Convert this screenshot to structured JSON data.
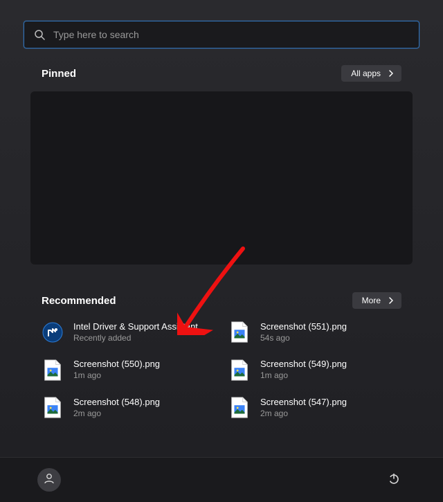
{
  "search": {
    "placeholder": "Type here to search"
  },
  "pinned": {
    "title": "Pinned",
    "all_apps_label": "All apps"
  },
  "recommended": {
    "title": "Recommended",
    "more_label": "More",
    "items": [
      {
        "title": "Intel Driver & Support Assistant",
        "sub": "Recently added",
        "icon": "intel"
      },
      {
        "title": "Screenshot (551).png",
        "sub": "54s ago",
        "icon": "image"
      },
      {
        "title": "Screenshot (550).png",
        "sub": "1m ago",
        "icon": "image"
      },
      {
        "title": "Screenshot (549).png",
        "sub": "1m ago",
        "icon": "image"
      },
      {
        "title": "Screenshot (548).png",
        "sub": "2m ago",
        "icon": "image"
      },
      {
        "title": "Screenshot (547).png",
        "sub": "2m ago",
        "icon": "image"
      }
    ]
  }
}
